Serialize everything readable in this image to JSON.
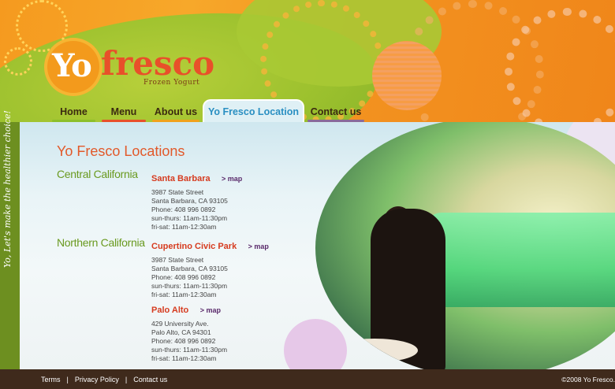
{
  "logo": {
    "yo": "Yo",
    "fresco": "fresco",
    "tagline": "Frozen Yogurt"
  },
  "nav": [
    {
      "label": "Home",
      "underline": "#8cbf2a",
      "width": 63
    },
    {
      "label": "Menu",
      "underline": "#e8502a",
      "width": 64
    },
    {
      "label": "About us",
      "underline": "#f0a21c",
      "width": 68
    },
    {
      "label": "Yo Fresco Location",
      "underline": "#2a8fc2",
      "width": 129,
      "active": true
    },
    {
      "label": "Contact us",
      "underline": "#8a6a9a",
      "width": 80
    }
  ],
  "side_slogan": "Yo, Let's make the healthier choice!",
  "main": {
    "title": "Yo Fresco Locations",
    "regions": [
      "Central California",
      "Northern California"
    ],
    "map_label": "> map",
    "stores": [
      {
        "name": "Santa Barbara",
        "lines": [
          "3987 State Street",
          "Santa Barbara, CA 93105",
          "Phone: 408 996 0892",
          "sun-thurs: 11am-11:30pm",
          "fri-sat: 11am-12:30am"
        ]
      },
      {
        "name": "Cupertino Civic Park",
        "lines": [
          "3987 State Street",
          "Santa Barbara, CA 93105",
          "Phone: 408 996 0892",
          "sun-thurs: 11am-11:30pm",
          "fri-sat: 11am-12:30am"
        ]
      },
      {
        "name": "Palo Alto",
        "lines": [
          "429 University Ave.",
          "Palo Alto, CA 94301",
          "Phone: 408 996 0892",
          "sun-thurs: 11am-11:30pm",
          "fri-sat: 11am-12:30am"
        ]
      }
    ]
  },
  "footer": {
    "links": [
      "Terms",
      "Privacy Policy",
      "Contact us"
    ],
    "copyright": "©2008 Yo Fresco."
  }
}
